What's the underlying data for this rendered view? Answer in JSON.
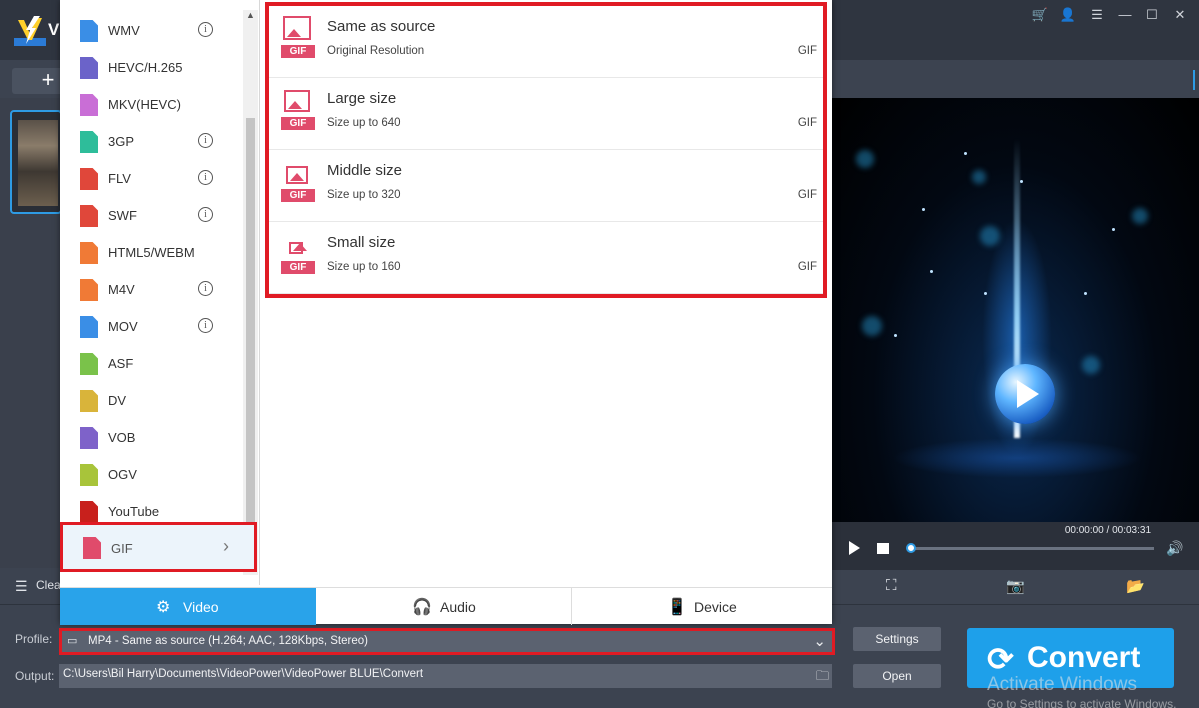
{
  "app": {
    "name_initial": "V"
  },
  "window_controls": [
    "cart-icon",
    "user-icon",
    "menu-icon",
    "minimize-icon",
    "maximize-icon",
    "close-icon"
  ],
  "toolbar": {
    "add_label": "+"
  },
  "file_list": {
    "clear_label": "Clea"
  },
  "format_list": {
    "items": [
      {
        "label": "WMV",
        "icon_color": "#3a8ee6",
        "info": true
      },
      {
        "label": "HEVC/H.265",
        "icon_color": "#6b63c9",
        "info": false
      },
      {
        "label": "MKV(HEVC)",
        "icon_color": "#c96ed6",
        "info": false
      },
      {
        "label": "3GP",
        "icon_color": "#2ebd9a",
        "info": true
      },
      {
        "label": "FLV",
        "icon_color": "#e0473a",
        "info": true
      },
      {
        "label": "SWF",
        "icon_color": "#e0473a",
        "info": true
      },
      {
        "label": "HTML5/WEBM",
        "icon_color": "#f07a36",
        "info": false
      },
      {
        "label": "M4V",
        "icon_color": "#f07a36",
        "info": true
      },
      {
        "label": "MOV",
        "icon_color": "#3a8ee6",
        "info": true
      },
      {
        "label": "ASF",
        "icon_color": "#7ac24a",
        "info": false
      },
      {
        "label": "DV",
        "icon_color": "#d9b43a",
        "info": false
      },
      {
        "label": "VOB",
        "icon_color": "#7e62c9",
        "info": false
      },
      {
        "label": "OGV",
        "icon_color": "#a8c43a",
        "info": false
      },
      {
        "label": "YouTube",
        "icon_color": "#c8201c",
        "info": false
      }
    ],
    "info_glyph": "i",
    "selected": {
      "label": "GIF",
      "chevron": "›"
    }
  },
  "gif_options": [
    {
      "title": "Same as source",
      "subtitle": "Original Resolution",
      "format": "GIF",
      "badge": "GIF"
    },
    {
      "title": "Large size",
      "subtitle": "Size up to 640",
      "format": "GIF",
      "badge": "GIF"
    },
    {
      "title": "Middle size",
      "subtitle": "Size up to 320",
      "format": "GIF",
      "badge": "GIF"
    },
    {
      "title": "Small size",
      "subtitle": "Size up to 160",
      "format": "GIF",
      "badge": "GIF"
    }
  ],
  "popup_tabs": {
    "video": "Video",
    "audio": "Audio",
    "device": "Device",
    "active": "video"
  },
  "player": {
    "timecode": "00:00:00 / 00:03:31",
    "progress": 0.0
  },
  "profile": {
    "label": "Profile:",
    "value": "MP4 - Same as source (H.264; AAC, 128Kbps, Stereo)"
  },
  "output": {
    "label": "Output:",
    "path": "C:\\Users\\Bil Harry\\Documents\\VideoPower\\VideoPower BLUE\\Convert"
  },
  "buttons": {
    "settings": "Settings",
    "open": "Open",
    "convert": "Convert"
  },
  "watermark": {
    "title": "Activate Windows",
    "subtitle": "Go to Settings to activate Windows."
  },
  "colors": {
    "accent": "#29a3ea",
    "highlight": "#e01b24",
    "gif_pink": "#e04b6b",
    "app_bg": "#3c4350"
  }
}
